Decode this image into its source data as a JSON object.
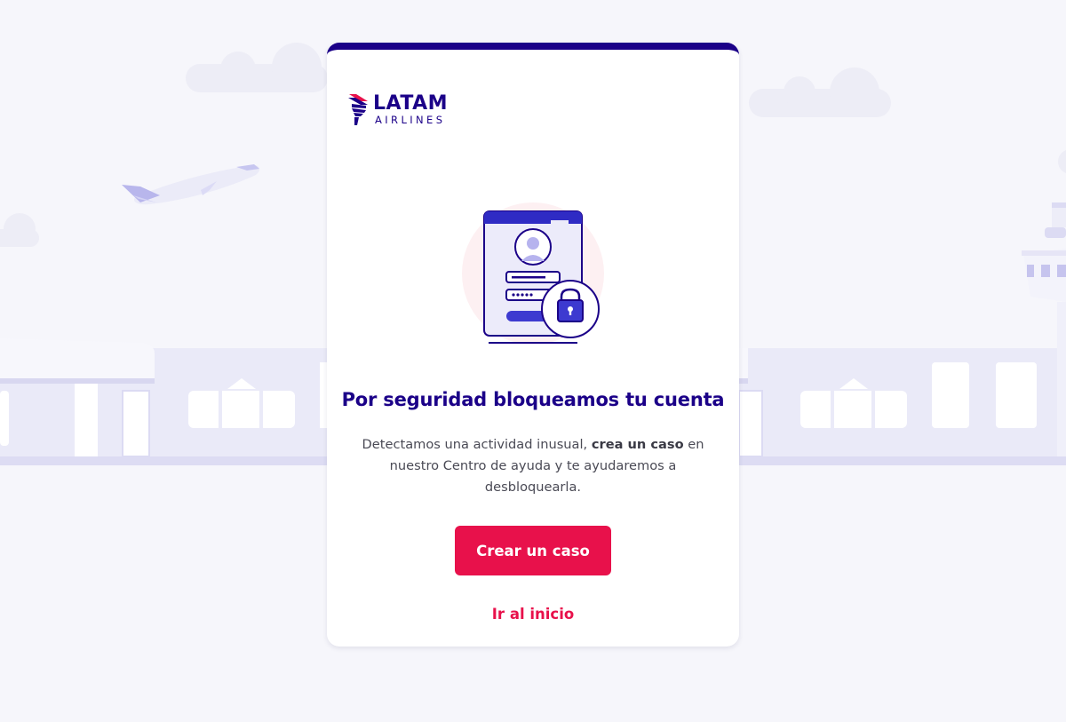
{
  "brand": {
    "name": "LATAM",
    "sub": "AIRLINES",
    "primary_color": "#1b0088",
    "accent_color": "#e8114b"
  },
  "illustration": {
    "icon": "locked-account-icon"
  },
  "message": {
    "title": "Por seguridad bloqueamos tu cuenta",
    "description_before": "Detectamos una actividad inusual, ",
    "description_bold": "crea un caso",
    "description_after": " en nuestro Centro de ayuda y te ayudaremos a desbloquearla."
  },
  "actions": {
    "primary_label": "Crear un caso",
    "secondary_label": "Ir al inicio"
  }
}
